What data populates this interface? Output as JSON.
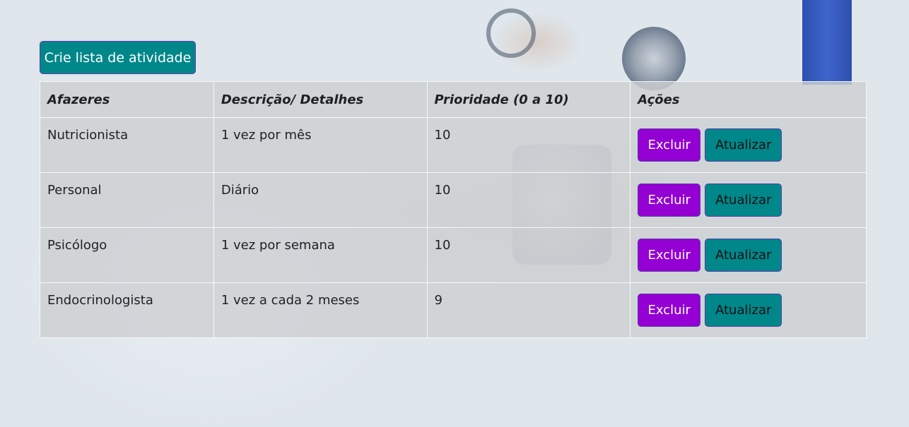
{
  "create_button_label": "Crie lista de atividade",
  "table": {
    "headers": [
      "Afazeres",
      "Descrição/ Detalhes",
      "Prioridade (0 a 10)",
      "Ações"
    ],
    "rows": [
      {
        "task": "Nutricionista",
        "description": "1 vez por mês",
        "priority": "10",
        "delete_label": "Excluir",
        "update_label": "Atualizar"
      },
      {
        "task": "Personal",
        "description": "Diário",
        "priority": "10",
        "delete_label": "Excluir",
        "update_label": "Atualizar"
      },
      {
        "task": "Psicólogo",
        "description": "1 vez por semana",
        "priority": "10",
        "delete_label": "Excluir",
        "update_label": "Atualizar"
      },
      {
        "task": "Endocrinologista",
        "description": "1 vez a cada 2 meses",
        "priority": "9",
        "delete_label": "Excluir",
        "update_label": "Atualizar"
      }
    ]
  },
  "colors": {
    "create_button": "#00878a",
    "delete_button": "#9400d3",
    "update_button": "#00878a",
    "button_border": "#5a3aa8"
  }
}
